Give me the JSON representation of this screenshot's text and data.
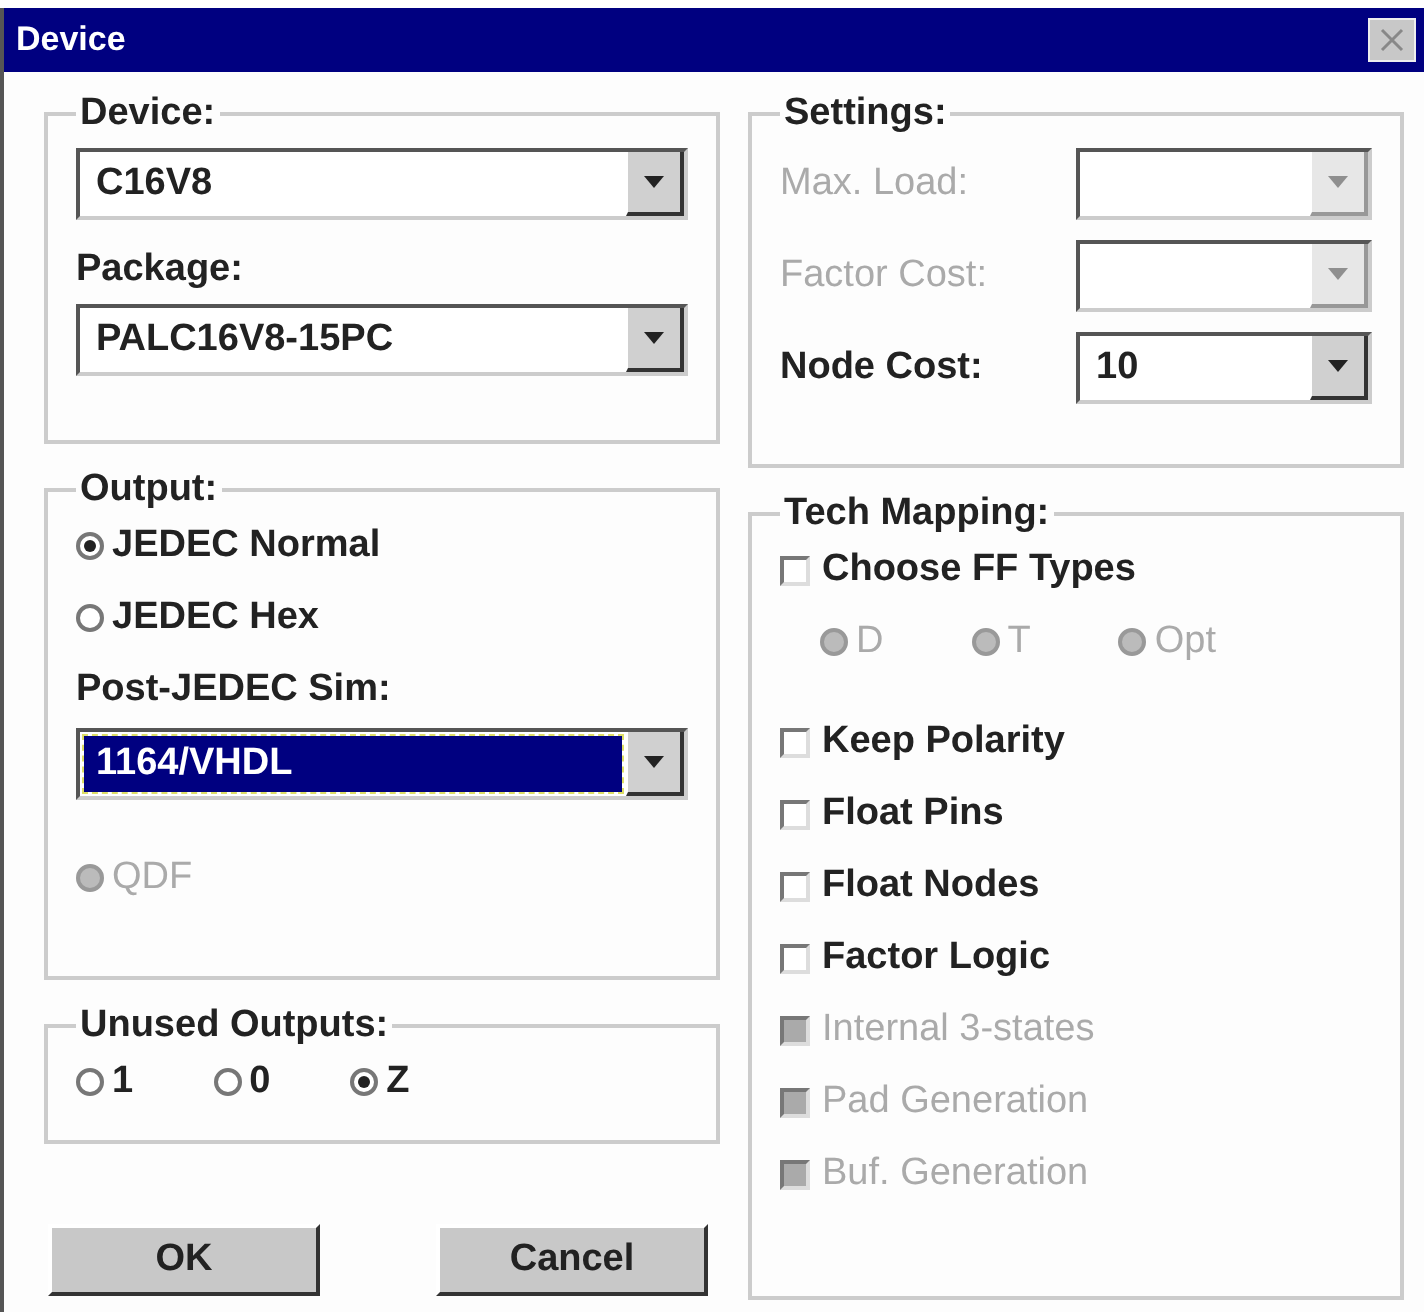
{
  "window": {
    "title": "Device"
  },
  "device": {
    "fields": [
      {
        "label": "Device:",
        "value": "C16V8"
      },
      {
        "label": "Package:",
        "value": "PALC16V8-15PC"
      }
    ]
  },
  "settings": {
    "title": "Settings:",
    "rows": [
      {
        "label": "Max. Load:",
        "disabled": true
      },
      {
        "label": "Factor Cost:",
        "disabled": true
      },
      {
        "label": "Node Cost:",
        "value": "10",
        "disabled": false
      }
    ]
  },
  "output": {
    "title": "Output:",
    "items": [
      {
        "kind": "radio",
        "label": "JEDEC Normal",
        "selected": true,
        "disabled": false
      },
      {
        "kind": "radio",
        "label": "JEDEC Hex",
        "selected": false,
        "disabled": false
      },
      {
        "kind": "combo",
        "label": "Post-JEDEC Sim:",
        "value": "1164/VHDL",
        "focused": true
      },
      {
        "kind": "radio",
        "label": "QDF",
        "selected": false,
        "disabled": true
      }
    ]
  },
  "unused_outputs": {
    "title": "Unused Outputs:",
    "options": [
      {
        "label": "1",
        "selected": false
      },
      {
        "label": "0",
        "selected": false
      },
      {
        "label": "Z",
        "selected": true
      }
    ]
  },
  "tech_mapping": {
    "title": "Tech Mapping:",
    "items": [
      {
        "kind": "checkbox",
        "label": "Choose FF Types",
        "checked": false,
        "disabled": false
      },
      {
        "kind": "radios",
        "options": [
          {
            "label": "D",
            "selected": false,
            "disabled": true
          },
          {
            "label": "T",
            "selected": false,
            "disabled": true
          },
          {
            "label": "Opt",
            "selected": false,
            "disabled": true
          }
        ]
      },
      {
        "kind": "checkbox",
        "label": "Keep Polarity",
        "checked": false,
        "disabled": false
      },
      {
        "kind": "checkbox",
        "label": "Float Pins",
        "checked": false,
        "disabled": false
      },
      {
        "kind": "checkbox",
        "label": "Float Nodes",
        "checked": false,
        "disabled": false
      },
      {
        "kind": "checkbox",
        "label": "Factor Logic",
        "checked": false,
        "disabled": false
      },
      {
        "kind": "checkbox",
        "label": "Internal 3-states",
        "checked": false,
        "disabled": true
      },
      {
        "kind": "checkbox",
        "label": "Pad Generation",
        "checked": false,
        "disabled": true
      },
      {
        "kind": "checkbox",
        "label": "Buf. Generation",
        "checked": false,
        "disabled": true
      }
    ]
  },
  "buttons": [
    "OK",
    "Cancel"
  ]
}
